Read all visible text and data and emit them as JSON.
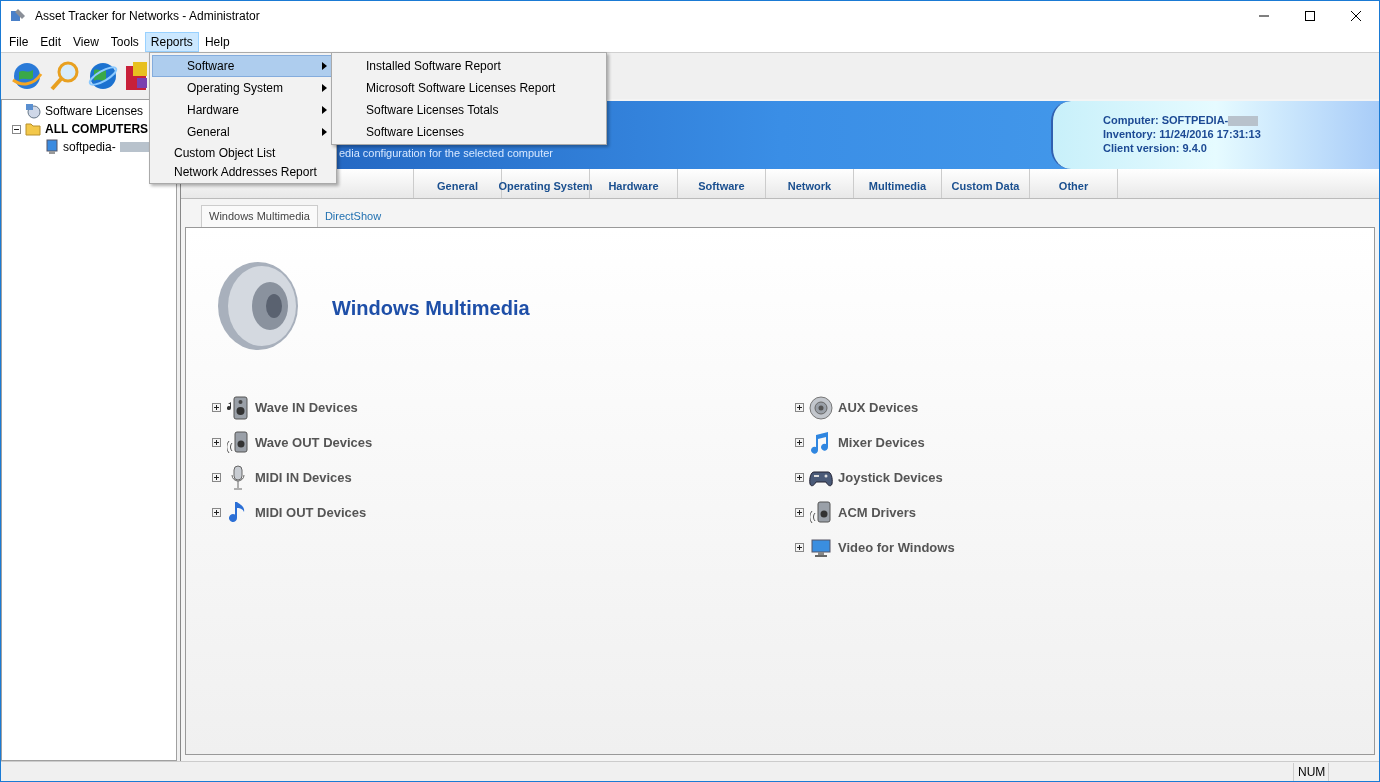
{
  "window": {
    "title": "Asset Tracker for Networks - Administrator"
  },
  "menubar": [
    {
      "label": "File",
      "selected": false
    },
    {
      "label": "Edit",
      "selected": false
    },
    {
      "label": "View",
      "selected": false
    },
    {
      "label": "Tools",
      "selected": false
    },
    {
      "label": "Reports",
      "selected": true
    },
    {
      "label": "Help",
      "selected": false
    }
  ],
  "menu": [
    {
      "label": "Software",
      "kind": "submenu",
      "selected": true
    },
    {
      "label": "Operating System",
      "kind": "submenu",
      "selected": false
    },
    {
      "label": "Hardware",
      "kind": "submenu",
      "selected": false
    },
    {
      "label": "General",
      "kind": "submenu",
      "selected": false
    },
    {
      "label": "Custom Object List",
      "kind": "item",
      "selected": false
    },
    {
      "label": "Network Addresses Report",
      "kind": "item",
      "selected": false
    }
  ],
  "submenu": [
    "Installed Software Report",
    "Microsoft Software Licenses Report",
    "Software Licenses Totals",
    "Software Licenses"
  ],
  "tree": [
    {
      "label": "Software Licenses",
      "bold": false
    },
    {
      "label": "ALL COMPUTERS",
      "bold": true,
      "expanded": true,
      "children": [
        {
          "label": "softpedia-",
          "bold": false
        }
      ]
    }
  ],
  "header": {
    "description": "edia configuration for the selected computer",
    "computer": "Computer: SOFTPEDIA-",
    "inventory": "Inventory: 11/24/2016 17:31:13",
    "client_version": "Client version: 9.4.0"
  },
  "tabs": [
    "General",
    "Operating System",
    "Hardware",
    "Software",
    "Network",
    "Multimedia",
    "Custom Data",
    "Other"
  ],
  "subtabs": [
    {
      "label": "Windows Multimedia",
      "selected": true
    },
    {
      "label": "DirectShow",
      "selected": false
    }
  ],
  "section_title": "Windows Multimedia",
  "devices_left": [
    "Wave IN Devices",
    "Wave OUT Devices",
    "MIDI IN Devices",
    "MIDI OUT Devices"
  ],
  "devices_right": [
    "AUX Devices",
    "Mixer Devices",
    "Joystick Devices",
    "ACM Drivers",
    "Video for Windows"
  ],
  "status_bar": {
    "num": "NUM"
  }
}
